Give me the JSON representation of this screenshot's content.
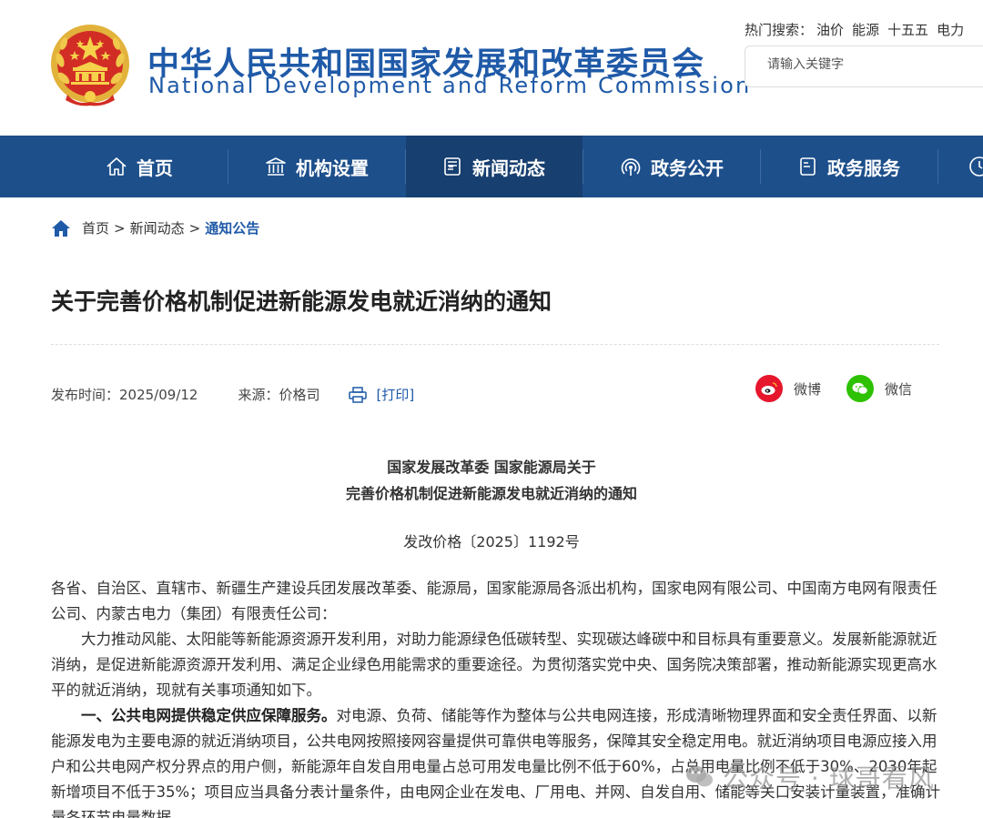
{
  "header": {
    "title_cn": "中华人民共和国国家发展和改革委员会",
    "title_en": "National Development and Reform Commission",
    "hot_search_label": "热门搜索：",
    "hot_search_terms": [
      "油价",
      "能源",
      "十五五",
      "电力"
    ],
    "search_placeholder": "请输入关键字"
  },
  "nav": {
    "items": [
      {
        "label": "首页",
        "icon": "home-icon"
      },
      {
        "label": "机构设置",
        "icon": "institution-icon"
      },
      {
        "label": "新闻动态",
        "icon": "news-icon"
      },
      {
        "label": "政务公开",
        "icon": "broadcast-icon"
      },
      {
        "label": "政务服务",
        "icon": "service-icon"
      }
    ],
    "active_index": 2
  },
  "breadcrumb": {
    "items": [
      "首页",
      "新闻动态",
      "通知公告"
    ],
    "separator": ">"
  },
  "article": {
    "title": "关于完善价格机制促进新能源发电就近消纳的通知",
    "publish_time": "发布时间：2025/09/12",
    "source": "来源：价格司",
    "print_label": "[打印]",
    "share": {
      "weibo": "微博",
      "wechat": "微信"
    },
    "doc_heading_line1": "国家发展改革委 国家能源局关于",
    "doc_heading_line2": "完善价格机制促进新能源发电就近消纳的通知",
    "doc_number": "发改价格〔2025〕1192号",
    "recipients": "各省、自治区、直辖市、新疆生产建设兵团发展改革委、能源局，国家能源局各派出机构，国家电网有限公司、中国南方电网有限责任公司、内蒙古电力（集团）有限责任公司：",
    "para1": "大力推动风能、太阳能等新能源资源开发利用，对助力能源绿色低碳转型、实现碳达峰碳中和目标具有重要意义。发展新能源就近消纳，是促进新能源资源开发利用、满足企业绿色用能需求的重要途径。为贯彻落实党中央、国务院决策部署，推动新能源实现更高水平的就近消纳，现就有关事项通知如下。",
    "para2_bold": "一、公共电网提供稳定供应保障服务。",
    "para2_rest": "对电源、负荷、储能等作为整体与公共电网连接，形成清晰物理界面和安全责任界面、以新能源发电为主要电源的就近消纳项目，公共电网按照接网容量提供可靠供电等服务，保障其安全稳定用电。就近消纳项目电源应接入用户和公共电网产权分界点的用户侧，新能源年自发自用电量占总可用发电量比例不低于60%，占总用电量比例不低于30%、2030年起新增项目不低于35%；项目应当具备分表计量条件，由电网企业在发电、厂用电、并网、自发自用、储能等关口安装计量装置，准确计量各环节电量数据。"
  },
  "watermark": "公众号 · 球哥看风",
  "colors": {
    "brand_blue": "#1f5aa8",
    "nav_bg": "#1d4f8b",
    "nav_active": "#173f70",
    "weibo_red": "#e6162d",
    "wechat_green": "#2dc100"
  }
}
